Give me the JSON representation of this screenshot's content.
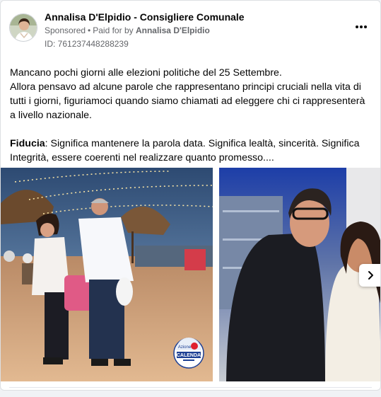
{
  "post": {
    "page_name": "Annalisa D'Elpidio - Consigliere Comunale",
    "sponsored_label": "Sponsored",
    "separator": "•",
    "paid_for_prefix": "Paid for by",
    "paid_for_name": "Annalisa D'Elpidio",
    "ad_id": "ID: 761237448288239",
    "more_options_icon": "more-horizontal-icon",
    "text": {
      "line1": "Mancano pochi giorni alle elezioni politiche del 25 Settembre.",
      "line2": "Allora pensavo ad alcune parole che rappresentano principi cruciali nella vita di tutti i giorni, figuriamoci quando siamo chiamati ad eleggere chi ci rappresenterà a livello nazionale.",
      "bold_word": "Fiducia",
      "line3_rest": ": Significa mantenere la parola data. Significa lealtà, sincerità. Significa Integrità, essere coerenti nel realizzare quanto promesso...."
    }
  },
  "carousel": {
    "next_icon": "chevron-right-icon",
    "badge": {
      "top_text": "Azione",
      "main_text": "CALENDA"
    }
  },
  "colors": {
    "text_primary": "#050505",
    "text_secondary": "#65676b",
    "badge_blue": "#1c3f94",
    "badge_red": "#e0202e"
  }
}
